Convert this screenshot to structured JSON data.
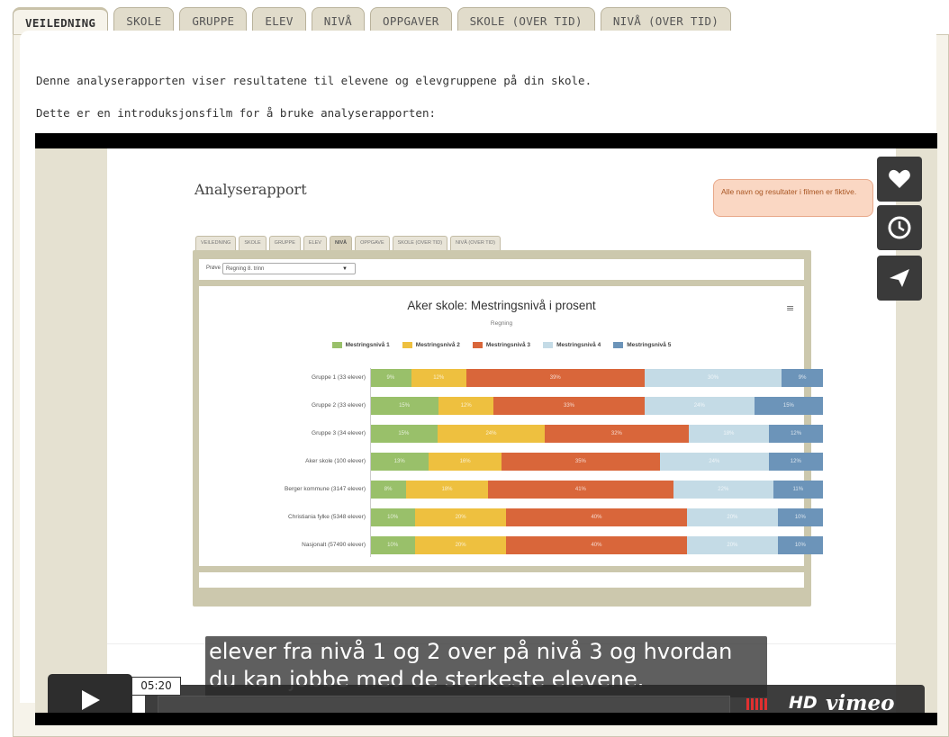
{
  "tabs": [
    {
      "label": "VEILEDNING",
      "active": true
    },
    {
      "label": "SKOLE",
      "active": false
    },
    {
      "label": "GRUPPE",
      "active": false
    },
    {
      "label": "ELEV",
      "active": false
    },
    {
      "label": "NIVÅ",
      "active": false
    },
    {
      "label": "OPPGAVER",
      "active": false
    },
    {
      "label": "SKOLE (OVER TID)",
      "active": false
    },
    {
      "label": "NIVÅ (OVER TID)",
      "active": false
    }
  ],
  "intro": {
    "line1": "Denne analyserapporten viser resultatene til elevene og elevgruppene på din skole.",
    "line2": "Dette er en introduksjonsfilm for å bruke analyserapporten:"
  },
  "video": {
    "caption_line1": "elever fra nivå 1 og 2 over på nivå 3 og hvordan",
    "caption_line2": "du kan jobbe med de sterkeste elevene.",
    "timecode": "05:20",
    "hd_label": "HD",
    "brand": "vimeo",
    "side_buttons": [
      {
        "icon": "heart-icon",
        "name": "like-button"
      },
      {
        "icon": "clock-icon",
        "name": "watch-later-button"
      },
      {
        "icon": "send-icon",
        "name": "share-button"
      }
    ],
    "frame": {
      "title": "Analyserapport",
      "note": "Alle navn og resultater i filmen er fiktive.",
      "tabs": [
        {
          "label": "VEILEDNING",
          "active": false
        },
        {
          "label": "SKOLE",
          "active": false
        },
        {
          "label": "GRUPPE",
          "active": false
        },
        {
          "label": "ELEV",
          "active": false
        },
        {
          "label": "NIVÅ",
          "active": true
        },
        {
          "label": "OPPGAVE",
          "active": false
        },
        {
          "label": "SKOLE (OVER TID)",
          "active": false
        },
        {
          "label": "NIVÅ (OVER TID)",
          "active": false
        }
      ],
      "select_label": "Prøve",
      "select_value": "Regning 8. trinn",
      "chart_menu_icon": "hamburger-icon",
      "chart_data": {
        "type": "bar",
        "orientation": "horizontal-stacked-percent",
        "title": "Aker skole: Mestringsnivå i prosent",
        "subtitle": "Regning",
        "legend_position": "top",
        "categories": [
          "Gruppe 1 (33 elever)",
          "Gruppe 2 (33 elever)",
          "Gruppe 3 (34 elever)",
          "Aker skole (100 elever)",
          "Berger kommune (3147 elever)",
          "Christiania fylke (5348 elever)",
          "Nasjonalt (57490 elever)"
        ],
        "series": [
          {
            "name": "Mestringsnivå 1",
            "color": "#99c06a",
            "values": [
              9,
              15,
              15,
              13,
              8,
              10,
              10
            ]
          },
          {
            "name": "Mestringsnivå 2",
            "color": "#eec03f",
            "values": [
              12,
              12,
              24,
              16,
              18,
              20,
              20
            ]
          },
          {
            "name": "Mestringsnivå 3",
            "color": "#d9663a",
            "values": [
              39,
              33,
              32,
              35,
              41,
              40,
              40
            ]
          },
          {
            "name": "Mestringsnivå 4",
            "color": "#c4dbe6",
            "values": [
              30,
              24,
              18,
              24,
              22,
              20,
              20
            ]
          },
          {
            "name": "Mestringsnivå 5",
            "color": "#6c94b9",
            "values": [
              9,
              15,
              12,
              12,
              11,
              10,
              10
            ]
          }
        ],
        "xlim": [
          0,
          100
        ]
      }
    }
  }
}
